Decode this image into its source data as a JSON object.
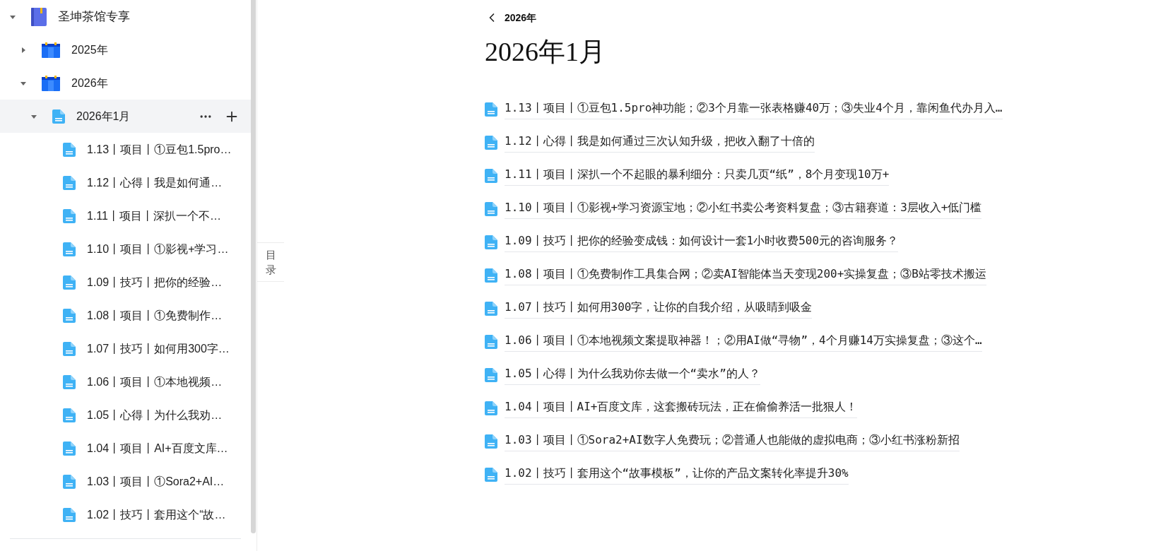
{
  "sidebar": {
    "tree": [
      {
        "label": "圣坤茶馆专享",
        "kind": "book",
        "expanded": true,
        "selected": false,
        "children": [
          {
            "label": "2025年",
            "kind": "calendar",
            "expanded": false,
            "selected": false
          },
          {
            "label": "2026年",
            "kind": "calendar",
            "expanded": true,
            "selected": false,
            "children": [
              {
                "label": "2026年1月",
                "kind": "doc",
                "expanded": true,
                "selected": true,
                "children": [
                  {
                    "label": "1.13丨项目丨①豆包1.5pro…",
                    "kind": "doc",
                    "selected": false
                  },
                  {
                    "label": "1.12丨心得丨我是如何通…",
                    "kind": "doc",
                    "selected": false
                  },
                  {
                    "label": "1.11丨项目丨深扒一个不…",
                    "kind": "doc",
                    "selected": false
                  },
                  {
                    "label": "1.10丨项目丨①影视+学习…",
                    "kind": "doc",
                    "selected": false
                  },
                  {
                    "label": "1.09丨技巧丨把你的经验…",
                    "kind": "doc",
                    "selected": false
                  },
                  {
                    "label": "1.08丨项目丨①免费制作…",
                    "kind": "doc",
                    "selected": false
                  },
                  {
                    "label": "1.07丨技巧丨如何用300字…",
                    "kind": "doc",
                    "selected": false
                  },
                  {
                    "label": "1.06丨项目丨①本地视频…",
                    "kind": "doc",
                    "selected": false
                  },
                  {
                    "label": "1.05丨心得丨为什么我劝…",
                    "kind": "doc",
                    "selected": false
                  },
                  {
                    "label": "1.04丨项目丨AI+百度文库…",
                    "kind": "doc",
                    "selected": false
                  },
                  {
                    "label": "1.03丨项目丨①Sora2+AI…",
                    "kind": "doc",
                    "selected": false
                  },
                  {
                    "label": "1.02丨技巧丨套用这个“故…",
                    "kind": "doc",
                    "selected": false
                  }
                ]
              }
            ]
          }
        ]
      }
    ]
  },
  "toc_tab": {
    "label": "目录"
  },
  "main": {
    "breadcrumb": "2026年",
    "title": "2026年1月",
    "articles": [
      "1.13丨项目丨①豆包1.5pro神功能；②3个月靠一张表格赚40万；③失业4个月，靠闲鱼代办月入…",
      "1.12丨心得丨我是如何通过三次认知升级，把收入翻了十倍的",
      "1.11丨项目丨深扒一个不起眼的暴利细分：只卖几页“纸”，8个月变现10万+",
      "1.10丨项目丨①影视+学习资源宝地；②小红书卖公考资料复盘；③古籍赛道：3层收入+低门槛",
      "1.09丨技巧丨把你的经验变成钱：如何设计一套1小时收费500元的咨询服务？",
      "1.08丨项目丨①免费制作工具集合网；②卖AI智能体当天变现200+实操复盘；③B站零技术搬运",
      "1.07丨技巧丨如何用300字，让你的自我介绍，从吸睛到吸金",
      "1.06丨项目丨①本地视频文案提取神器！；②用AI做“寻物”，4个月赚14万实操复盘；③这个…",
      "1.05丨心得丨为什么我劝你去做一个“卖水”的人？",
      "1.04丨项目丨AI+百度文库，这套搬砖玩法，正在偷偷养活一批狠人！",
      "1.03丨项目丨①Sora2+AI数字人免费玩；②普通人也能做的虚拟电商；③小红书涨粉新招",
      "1.02丨技巧丨套用这个“故事模板”，让你的产品文案转化率提升30%"
    ]
  }
}
